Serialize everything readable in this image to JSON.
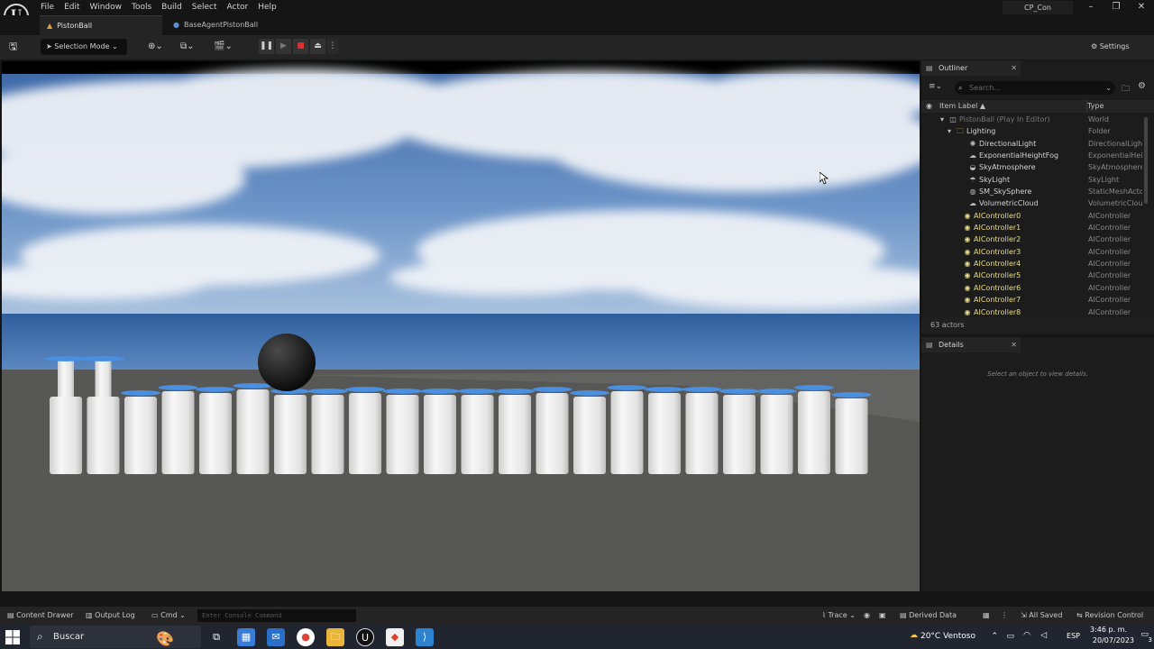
{
  "menubar": {
    "items": [
      "File",
      "Edit",
      "Window",
      "Tools",
      "Build",
      "Select",
      "Actor",
      "Help"
    ],
    "project": "CP_Con"
  },
  "tabs": [
    {
      "label": "PistonBall"
    },
    {
      "label": "BaseAgentPistonBall"
    }
  ],
  "toolbar": {
    "selection_mode": "Selection Mode",
    "settings": "Settings"
  },
  "outliner": {
    "title": "Outliner",
    "search_placeholder": "Search...",
    "col_label": "Item Label",
    "col_type": "Type",
    "rows": [
      {
        "label": "PistonBall (Play In Editor)",
        "type": "World",
        "depth": 0,
        "icon": "world-icon"
      },
      {
        "label": "Lighting",
        "type": "Folder",
        "depth": 1,
        "icon": "folder-icon"
      },
      {
        "label": "DirectionalLight",
        "type": "DirectionalLight",
        "depth": 2,
        "icon": "light-icon"
      },
      {
        "label": "ExponentialHeightFog",
        "type": "ExponentialHeig",
        "depth": 2,
        "icon": "fog-icon"
      },
      {
        "label": "SkyAtmosphere",
        "type": "SkyAtmosphere",
        "depth": 2,
        "icon": "sky-icon"
      },
      {
        "label": "SkyLight",
        "type": "SkyLight",
        "depth": 2,
        "icon": "skylight-icon"
      },
      {
        "label": "SM_SkySphere",
        "type": "StaticMeshActo",
        "depth": 2,
        "icon": "mesh-icon"
      },
      {
        "label": "VolumetricCloud",
        "type": "VolumetricClou",
        "depth": 2,
        "icon": "cloud-icon"
      },
      {
        "label": "AIController0",
        "type": "AIController",
        "depth": 1,
        "icon": "controller-icon"
      },
      {
        "label": "AIController1",
        "type": "AIController",
        "depth": 1,
        "icon": "controller-icon"
      },
      {
        "label": "AIController2",
        "type": "AIController",
        "depth": 1,
        "icon": "controller-icon"
      },
      {
        "label": "AIController3",
        "type": "AIController",
        "depth": 1,
        "icon": "controller-icon"
      },
      {
        "label": "AIController4",
        "type": "AIController",
        "depth": 1,
        "icon": "controller-icon"
      },
      {
        "label": "AIController5",
        "type": "AIController",
        "depth": 1,
        "icon": "controller-icon"
      },
      {
        "label": "AIController6",
        "type": "AIController",
        "depth": 1,
        "icon": "controller-icon"
      },
      {
        "label": "AIController7",
        "type": "AIController",
        "depth": 1,
        "icon": "controller-icon"
      },
      {
        "label": "AIController8",
        "type": "AIController",
        "depth": 1,
        "icon": "controller-icon"
      }
    ],
    "count": "63 actors"
  },
  "details": {
    "title": "Details",
    "empty_message": "Select an object to view details."
  },
  "statusbar": {
    "content_drawer": "Content Drawer",
    "output_log": "Output Log",
    "cmd": "Cmd",
    "console_placeholder": "Enter Console Command",
    "trace": "Trace",
    "derived_data": "Derived Data",
    "all_saved": "All Saved",
    "revision_control": "Revision Control"
  },
  "taskbar": {
    "search": "Buscar",
    "weather": "20°C  Ventoso",
    "lang": "ESP",
    "time": "3:46 p. m.",
    "date": "20/07/2023",
    "notif": "3"
  },
  "colors": {
    "accent": "#e0c14a",
    "piston_cap": "#4a8fe0",
    "controller_text": "#e8dc8a"
  }
}
